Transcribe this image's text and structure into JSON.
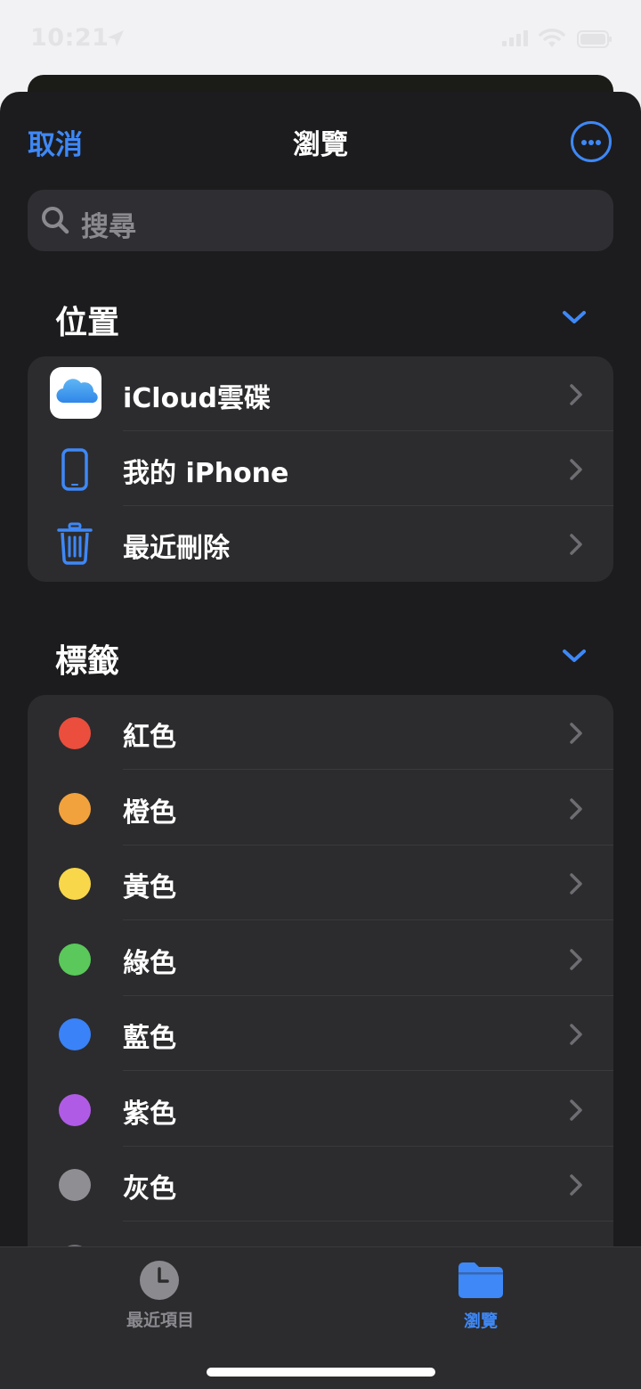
{
  "status_bar": {
    "time": "10:21"
  },
  "nav": {
    "cancel": "取消",
    "title": "瀏覽"
  },
  "search": {
    "placeholder": "搜尋"
  },
  "locations": {
    "heading": "位置",
    "items": [
      {
        "label": "iCloud雲碟",
        "icon": "icloud-icon"
      },
      {
        "label": "我的 iPhone",
        "icon": "iphone-icon"
      },
      {
        "label": "最近刪除",
        "icon": "trash-icon"
      }
    ]
  },
  "tags": {
    "heading": "標籤",
    "items": [
      {
        "label": "紅色",
        "color": "#eb4e3d"
      },
      {
        "label": "橙色",
        "color": "#f2a23c"
      },
      {
        "label": "黃色",
        "color": "#f8d74a"
      },
      {
        "label": "綠色",
        "color": "#5ac85a"
      },
      {
        "label": "藍色",
        "color": "#3a82f7"
      },
      {
        "label": "紫色",
        "color": "#b05be6"
      },
      {
        "label": "灰色",
        "color": "#8e8e93"
      }
    ]
  },
  "tabbar": {
    "tabs": [
      {
        "label": "最近項目",
        "icon": "clock-icon",
        "active": false
      },
      {
        "label": "瀏覽",
        "icon": "folder-icon",
        "active": true
      }
    ]
  },
  "colors": {
    "accent": "#3e88f7",
    "sheet": "#1c1c1e",
    "group": "#2c2c2e"
  }
}
